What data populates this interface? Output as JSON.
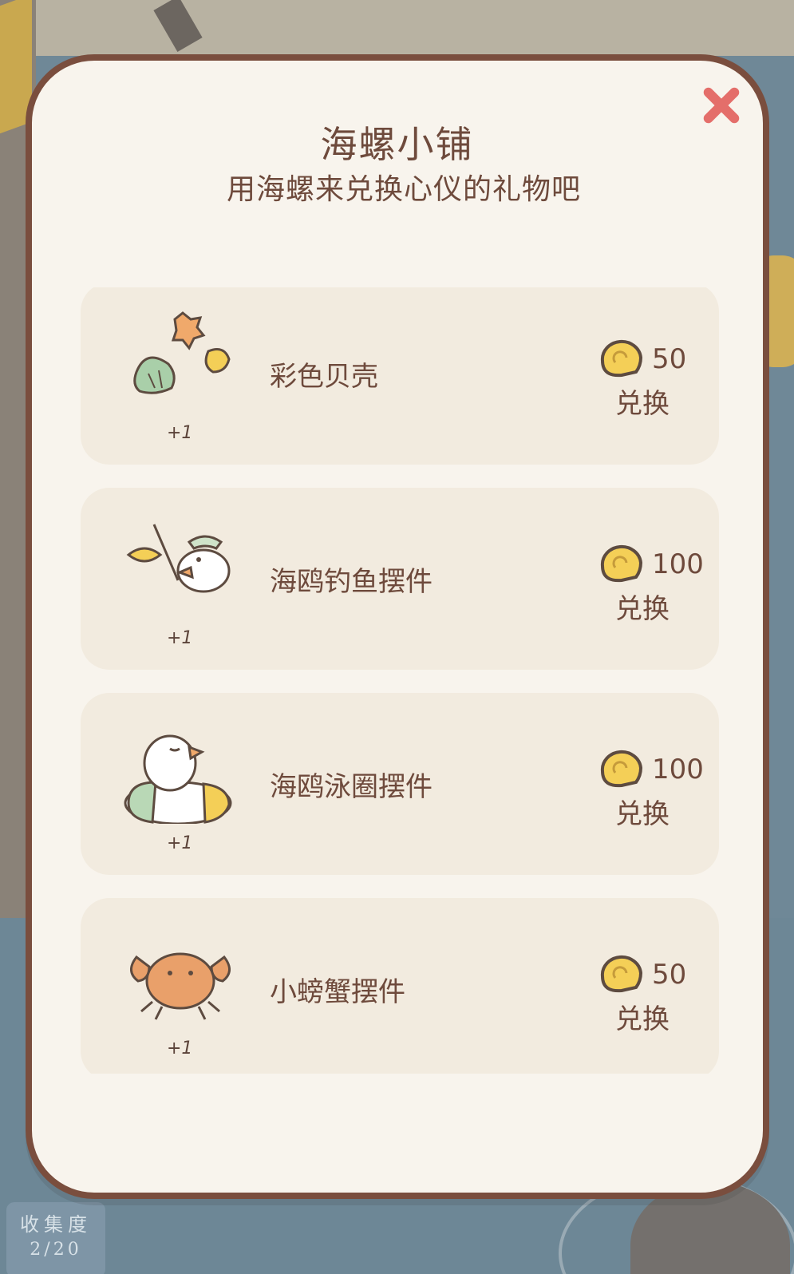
{
  "shop": {
    "title": "海螺小铺",
    "subtitle": "用海螺来兑换心仪的礼物吧"
  },
  "items": [
    {
      "name": "彩色贝壳",
      "qty": "+1",
      "price": "50",
      "action": "兑换",
      "icon": "colored-shells"
    },
    {
      "name": "海鸥钓鱼摆件",
      "qty": "+1",
      "price": "100",
      "action": "兑换",
      "icon": "seagull-fishing"
    },
    {
      "name": "海鸥泳圈摆件",
      "qty": "+1",
      "price": "100",
      "action": "兑换",
      "icon": "seagull-swim-ring"
    },
    {
      "name": "小螃蟹摆件",
      "qty": "+1",
      "price": "50",
      "action": "兑换",
      "icon": "crab"
    }
  ],
  "collection": {
    "label": "收集度",
    "value": "2/20"
  },
  "colors": {
    "border": "#7a4e3e",
    "panel": "#f8f4ed",
    "card": "#f2ebdf",
    "text": "#6e4a3c",
    "close": "#e46e6a",
    "coin": "#f4cf57"
  }
}
